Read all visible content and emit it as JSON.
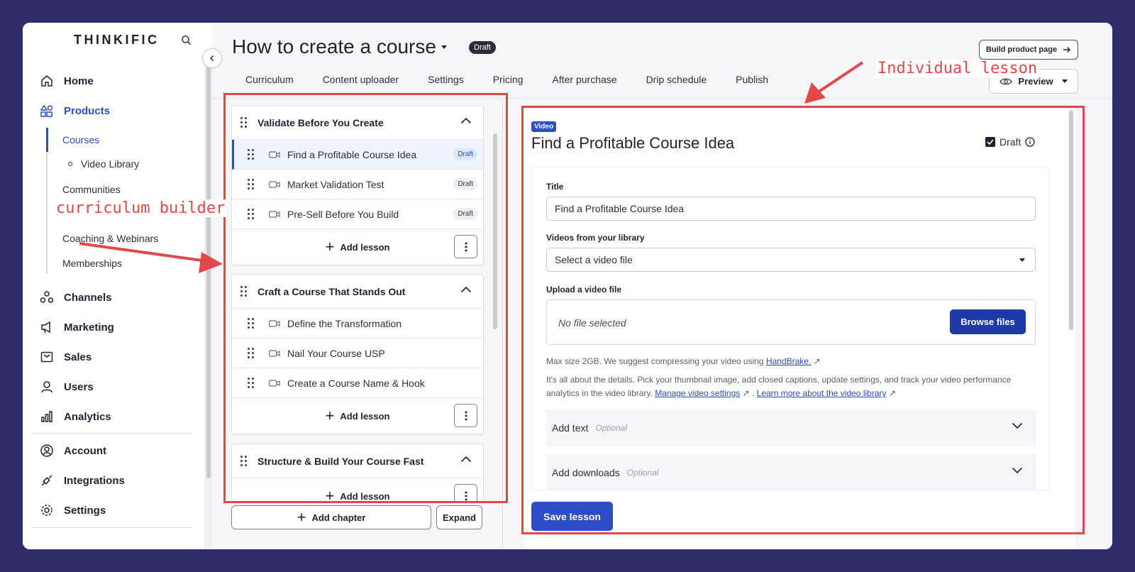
{
  "sidebar": {
    "logo": "THINKIFIC",
    "items": [
      {
        "label": "Home",
        "icon": "home-icon"
      },
      {
        "label": "Products",
        "icon": "products-icon",
        "active": true
      },
      {
        "label": "Channels",
        "icon": "channels-icon"
      },
      {
        "label": "Marketing",
        "icon": "marketing-icon"
      },
      {
        "label": "Sales",
        "icon": "sales-icon"
      },
      {
        "label": "Users",
        "icon": "users-icon"
      },
      {
        "label": "Analytics",
        "icon": "analytics-icon"
      },
      {
        "label": "Account",
        "icon": "account-icon"
      },
      {
        "label": "Integrations",
        "icon": "integrations-icon"
      },
      {
        "label": "Settings",
        "icon": "settings-icon"
      }
    ],
    "products_sub": [
      {
        "label": "Courses",
        "active": true
      },
      {
        "label": "Video Library"
      },
      {
        "label": "Communities"
      },
      {
        "label": "Coaching & Webinars"
      },
      {
        "label": "Memberships"
      }
    ]
  },
  "header": {
    "course_title": "How to create a course",
    "status_badge": "Draft",
    "build_product_label": "Build product page",
    "preview_label": "Preview",
    "tabs": [
      "Curriculum",
      "Content uploader",
      "Settings",
      "Pricing",
      "After purchase",
      "Drip schedule",
      "Publish"
    ]
  },
  "curriculum": {
    "chapters": [
      {
        "title": "Validate Before You Create",
        "lessons": [
          {
            "title": "Find a Profitable Course Idea",
            "status": "Draft",
            "selected": true
          },
          {
            "title": "Market Validation Test",
            "status": "Draft"
          },
          {
            "title": "Pre-Sell Before You Build",
            "status": "Draft"
          }
        ]
      },
      {
        "title": "Craft a Course That Stands Out",
        "lessons": [
          {
            "title": "Define the Transformation"
          },
          {
            "title": "Nail Your Course USP"
          },
          {
            "title": "Create a Course Name & Hook"
          }
        ]
      },
      {
        "title": "Structure & Build Your Course Fast",
        "lessons": []
      }
    ],
    "add_lesson_label": "Add lesson",
    "add_chapter_label": "Add chapter",
    "expand_label": "Expand"
  },
  "lesson": {
    "type_tag": "Video",
    "title": "Find a Profitable Course Idea",
    "draft_label": "Draft",
    "draft_checked": true,
    "title_label": "Title",
    "title_value": "Find a Profitable Course Idea",
    "library_label": "Videos from your library",
    "library_value": "Select a video file",
    "upload_label": "Upload a video file",
    "no_file_text": "No file selected",
    "browse_label": "Browse files",
    "max_size_text": "Max size 2GB. We suggest compressing your video using",
    "handbrake_link": "HandBrake.",
    "details_text": "It's all about the details. Pick your thumbnail image, add closed captions, update settings, and track your video performance analytics in the video library.",
    "manage_link": "Manage video settings",
    "separator": ".",
    "learn_link": "Learn more about the video library",
    "add_text_label": "Add text",
    "add_downloads_label": "Add downloads",
    "optional_label": "Optional",
    "save_label": "Save lesson"
  },
  "annotations": {
    "curriculum_label": "curriculum builder",
    "lesson_label": "Individual lesson",
    "color": "#e3474a"
  },
  "colors": {
    "accent": "#2b4ec6",
    "background": "#2d2c68"
  }
}
